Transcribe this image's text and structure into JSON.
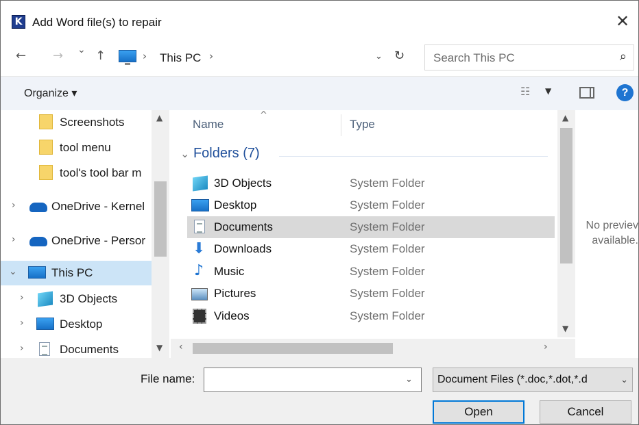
{
  "window": {
    "app_icon_letter": "K",
    "title": "Add Word file(s) to repair",
    "close_glyph": "✕"
  },
  "navigation": {
    "back_glyph": "←",
    "forward_glyph": "→",
    "recent_glyph": "⌄",
    "up_glyph": "↑",
    "breadcrumb": [
      "This PC"
    ],
    "refresh_glyph": "↻",
    "search_placeholder": "Search This PC"
  },
  "toolbar": {
    "organize_label": "Organize ▾"
  },
  "sidebar": {
    "items": [
      {
        "label": "Screenshots",
        "icon": "folder-icon"
      },
      {
        "label": "tool menu",
        "icon": "folder-icon"
      },
      {
        "label": "tool's tool bar m",
        "icon": "folder-icon"
      },
      {
        "label": "OneDrive - Kernel",
        "icon": "onedrive-icon"
      },
      {
        "label": "OneDrive - Persor",
        "icon": "onedrive-icon"
      },
      {
        "label": "This PC",
        "icon": "this-pc-icon",
        "selected": true
      },
      {
        "label": "3D Objects",
        "icon": "3d-objects-icon"
      },
      {
        "label": "Desktop",
        "icon": "desktop-icon"
      },
      {
        "label": "Documents",
        "icon": "documents-icon"
      }
    ]
  },
  "content": {
    "columns": {
      "name": "Name",
      "type": "Type"
    },
    "group_title": "Folders (7)",
    "rows": [
      {
        "name": "3D Objects",
        "type": "System Folder",
        "icon": "3d-objects-icon"
      },
      {
        "name": "Desktop",
        "type": "System Folder",
        "icon": "desktop-icon"
      },
      {
        "name": "Documents",
        "type": "System Folder",
        "icon": "documents-icon",
        "selected": true
      },
      {
        "name": "Downloads",
        "type": "System Folder",
        "icon": "downloads-icon"
      },
      {
        "name": "Music",
        "type": "System Folder",
        "icon": "music-icon"
      },
      {
        "name": "Pictures",
        "type": "System Folder",
        "icon": "pictures-icon"
      },
      {
        "name": "Videos",
        "type": "System Folder",
        "icon": "videos-icon"
      }
    ]
  },
  "preview": {
    "line1": "No previev",
    "line2": "available."
  },
  "bottom": {
    "file_name_label": "File name:",
    "file_name_value": "",
    "file_type_value": "Document Files (*.doc,*.dot,*.d",
    "open_label": "Open",
    "cancel_label": "Cancel"
  },
  "colors": {
    "selection": "#cce4f7",
    "accent": "#0078d7",
    "group_header": "#1e4e9a"
  }
}
